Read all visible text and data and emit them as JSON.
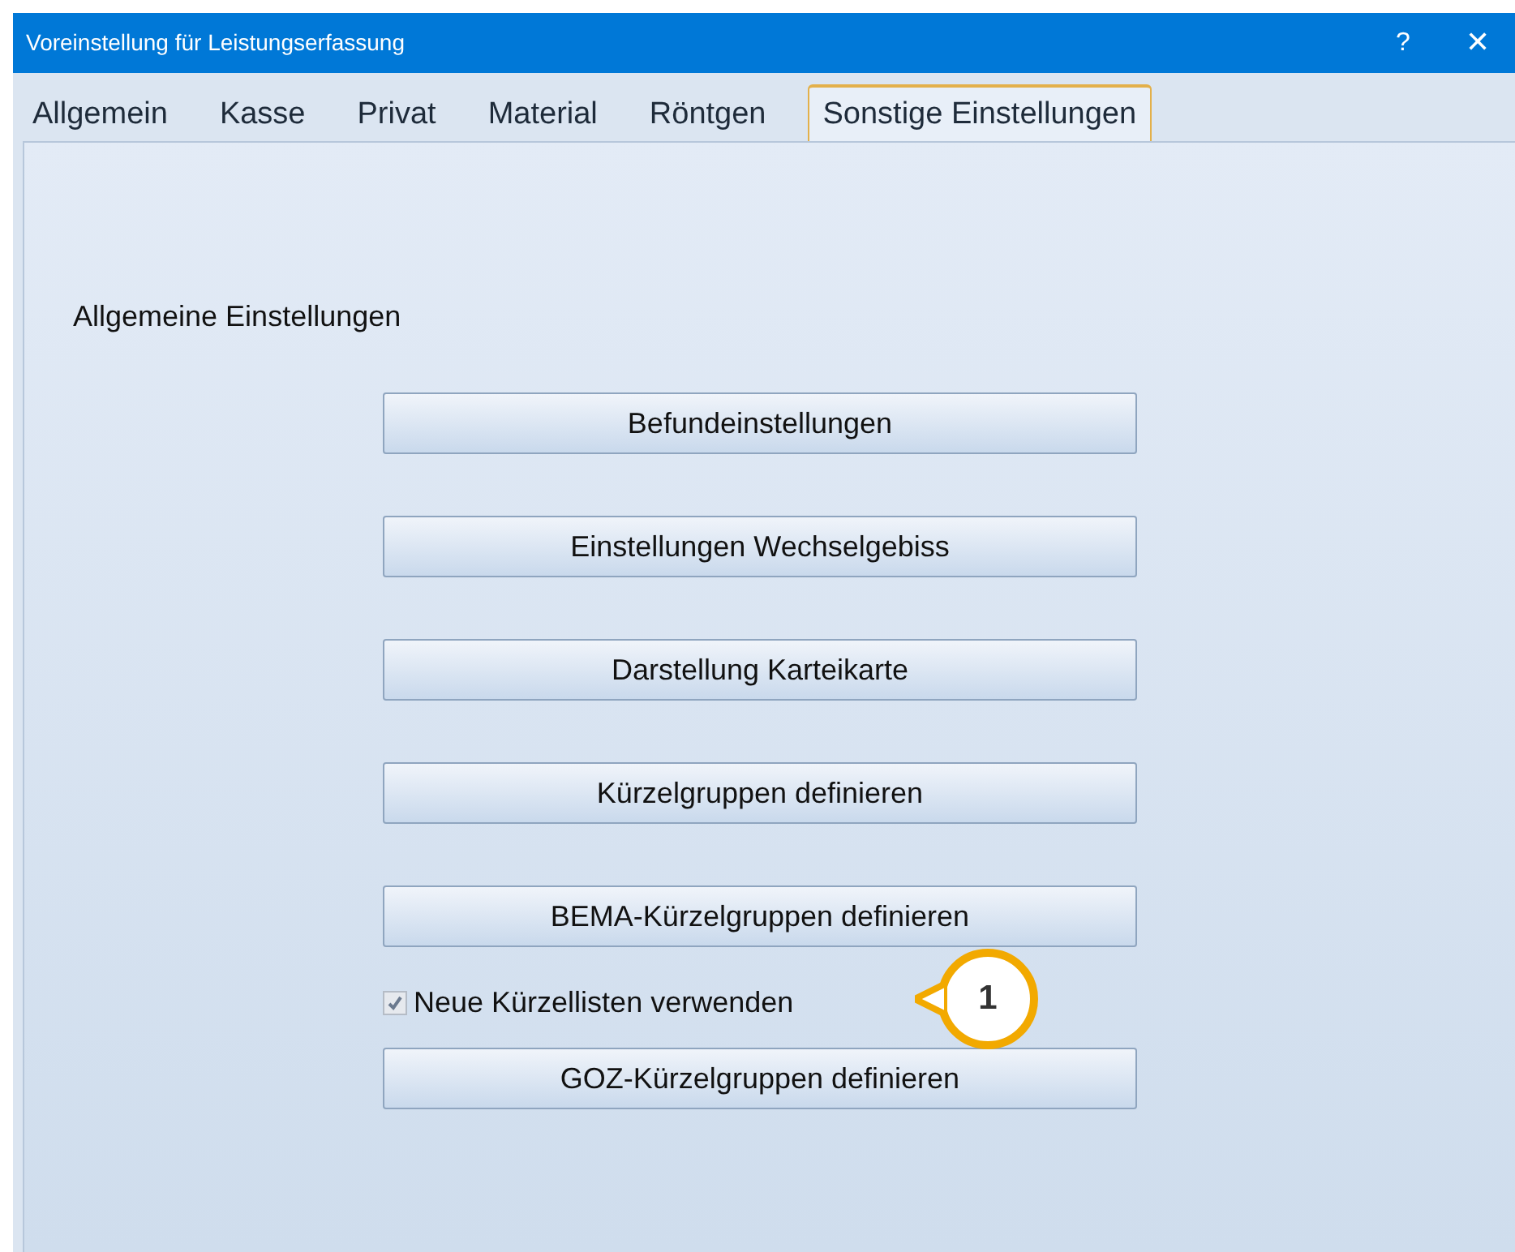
{
  "window": {
    "title": "Voreinstellung für Leistungserfassung",
    "help": "?",
    "close": "✕"
  },
  "tabs": [
    {
      "label": "Allgemein",
      "selected": false
    },
    {
      "label": "Kasse",
      "selected": false
    },
    {
      "label": "Privat",
      "selected": false
    },
    {
      "label": "Material",
      "selected": false
    },
    {
      "label": "Röntgen",
      "selected": false
    },
    {
      "label": "Sonstige Einstellungen",
      "selected": true
    }
  ],
  "section_title": "Allgemeine Einstellungen",
  "items": [
    {
      "kind": "button",
      "label": "Befundeinstellungen"
    },
    {
      "kind": "button",
      "label": "Einstellungen Wechselgebiss"
    },
    {
      "kind": "button",
      "label": "Darstellung Karteikarte"
    },
    {
      "kind": "button",
      "label": "Kürzelgruppen definieren"
    },
    {
      "kind": "button",
      "label": "BEMA-Kürzelgruppen definieren"
    },
    {
      "kind": "checkbox",
      "label": "Neue Kürzellisten verwenden",
      "checked": true,
      "disabled": true,
      "callout": "1"
    },
    {
      "kind": "button",
      "label": "GOZ-Kürzelgruppen definieren"
    }
  ]
}
